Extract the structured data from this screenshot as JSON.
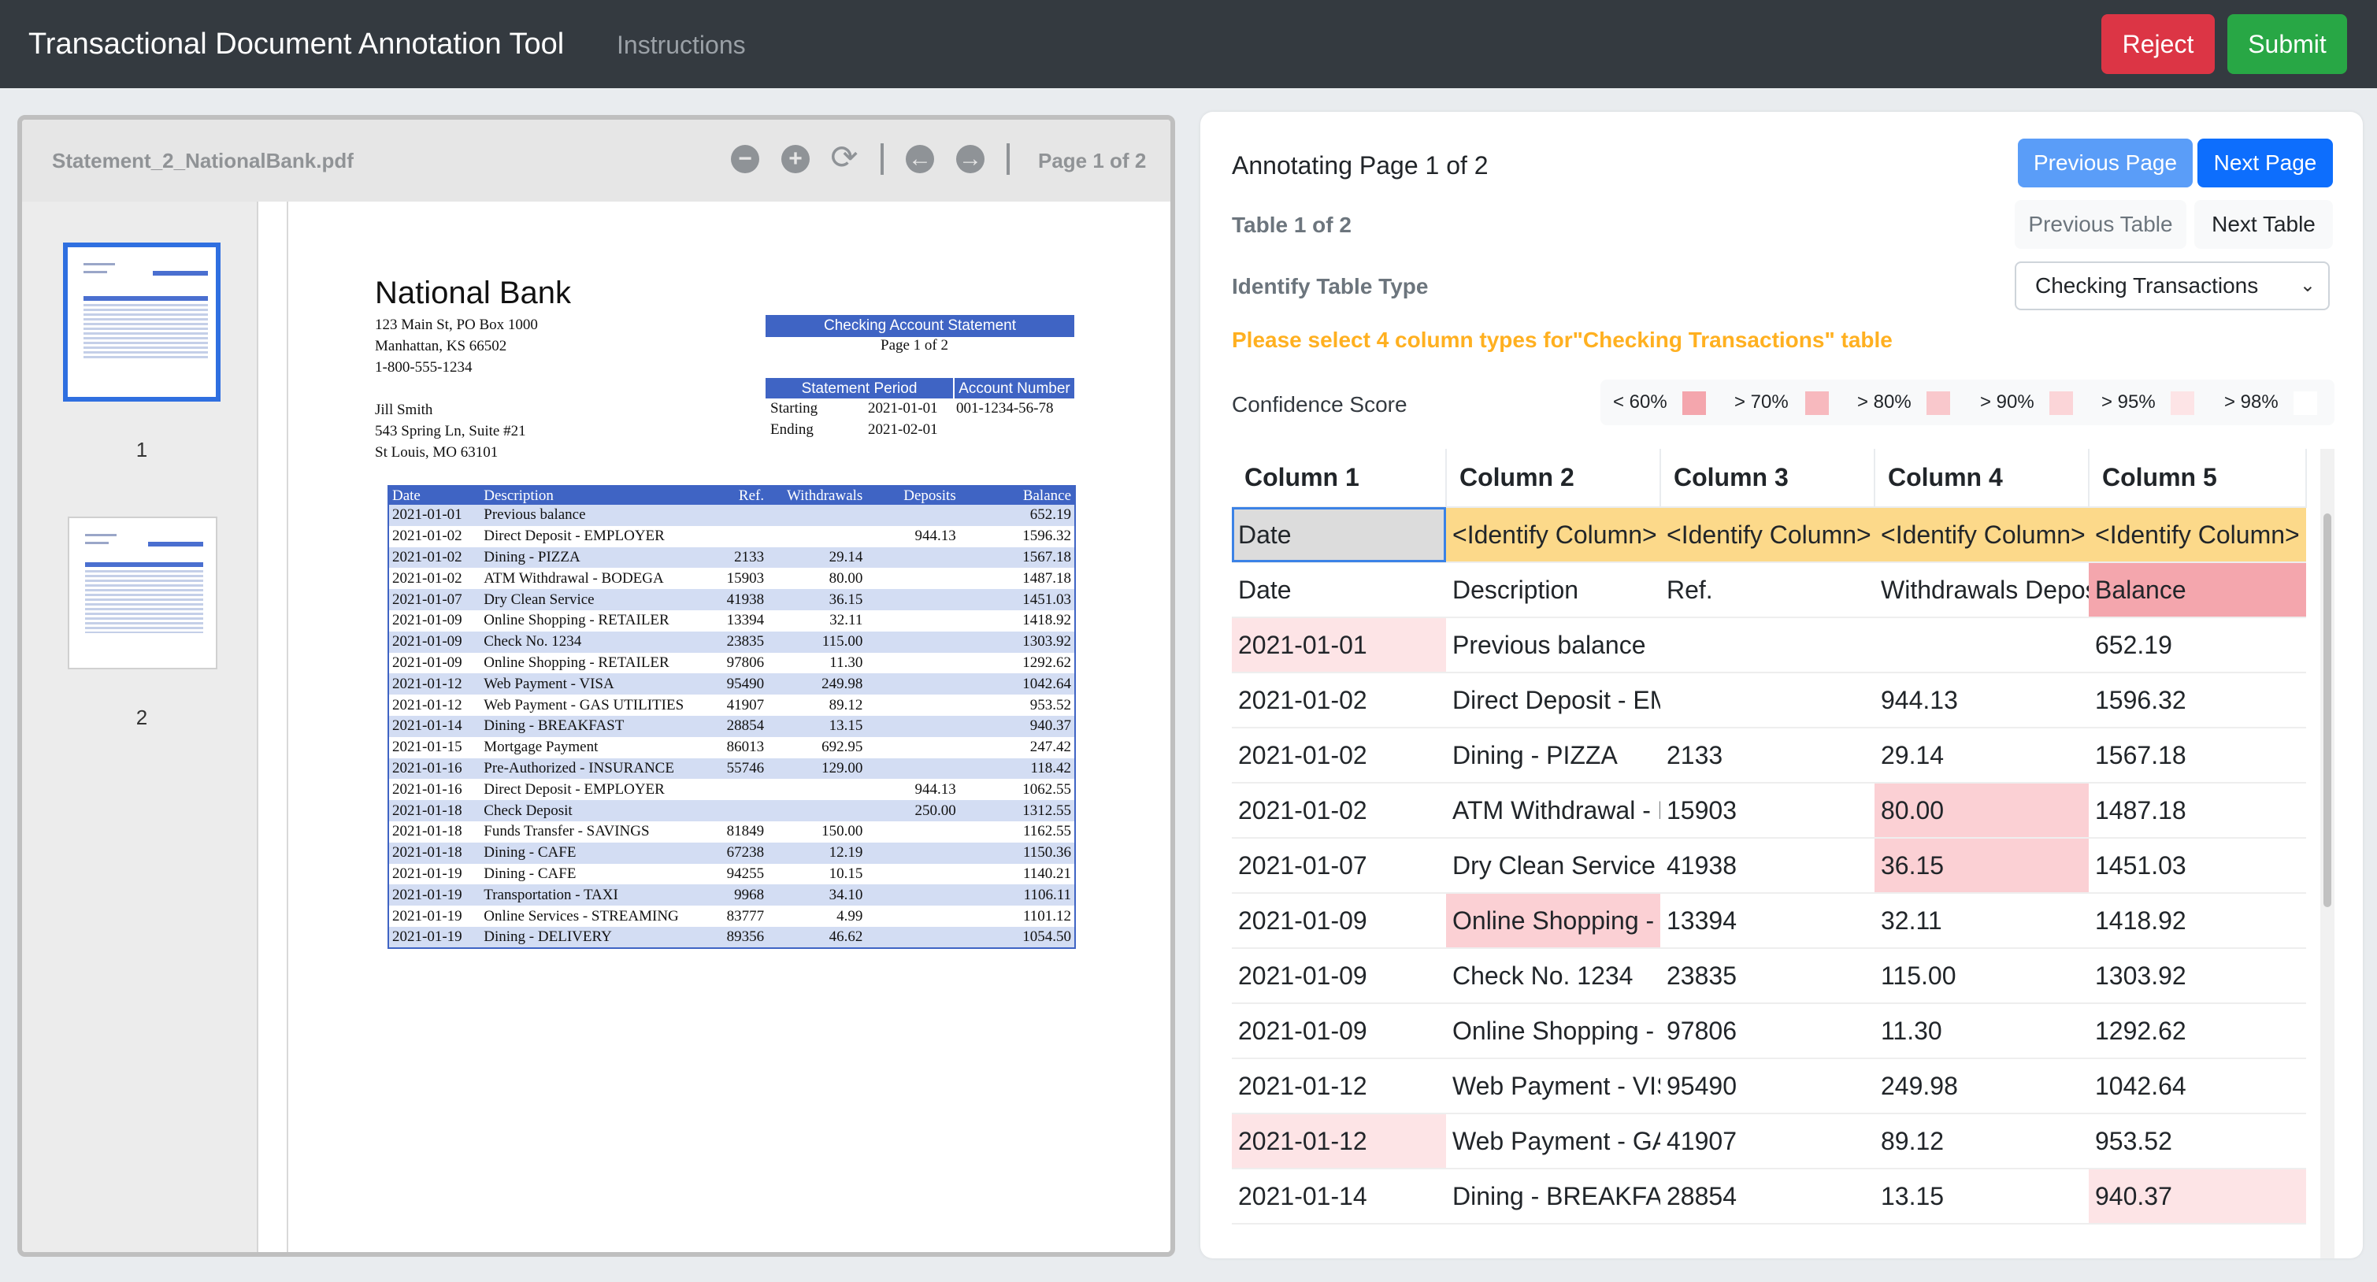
{
  "navbar": {
    "title": "Transactional Document Annotation Tool",
    "instructions": "Instructions",
    "reject_label": "Reject",
    "submit_label": "Submit"
  },
  "viewer": {
    "file_name": "Statement_2_NationalBank.pdf",
    "page_indicator": "Page 1 of 2",
    "toolbar_icons": [
      "zoom-out-icon",
      "zoom-in-icon",
      "refresh-icon",
      "arrow-left-icon",
      "arrow-right-icon"
    ],
    "thumbnails": [
      {
        "label": "1"
      },
      {
        "label": "2"
      }
    ]
  },
  "document": {
    "bank_name": "National Bank",
    "address_lines": [
      "123 Main St, PO Box 1000",
      "Manhattan, KS 66502",
      "1-800-555-1234"
    ],
    "customer_lines": [
      "Jill Smith",
      "543 Spring Ln, Suite #21",
      "St Louis, MO 63101"
    ],
    "statement_title": "Checking Account Statement",
    "statement_page": "Page 1 of 2",
    "period_header": "Statement Period",
    "account_header": "Account Number",
    "starting_label": "Starting",
    "starting_date": "2021-01-01",
    "account_number": "001-1234-56-78",
    "ending_label": "Ending",
    "ending_date": "2021-02-01",
    "table_headers": [
      "Date",
      "Description",
      "Ref.",
      "Withdrawals",
      "Deposits",
      "Balance"
    ],
    "rows": [
      [
        "2021-01-01",
        "Previous balance",
        "",
        "",
        "",
        "652.19"
      ],
      [
        "2021-01-02",
        "Direct Deposit - EMPLOYER",
        "",
        "",
        "944.13",
        "1596.32"
      ],
      [
        "2021-01-02",
        "Dining - PIZZA",
        "2133",
        "29.14",
        "",
        "1567.18"
      ],
      [
        "2021-01-02",
        "ATM Withdrawal - BODEGA",
        "15903",
        "80.00",
        "",
        "1487.18"
      ],
      [
        "2021-01-07",
        "Dry Clean Service",
        "41938",
        "36.15",
        "",
        "1451.03"
      ],
      [
        "2021-01-09",
        "Online Shopping - RETAILER",
        "13394",
        "32.11",
        "",
        "1418.92"
      ],
      [
        "2021-01-09",
        "Check No. 1234",
        "23835",
        "115.00",
        "",
        "1303.92"
      ],
      [
        "2021-01-09",
        "Online Shopping - RETAILER",
        "97806",
        "11.30",
        "",
        "1292.62"
      ],
      [
        "2021-01-12",
        "Web Payment - VISA",
        "95490",
        "249.98",
        "",
        "1042.64"
      ],
      [
        "2021-01-12",
        "Web Payment - GAS UTILITIES",
        "41907",
        "89.12",
        "",
        "953.52"
      ],
      [
        "2021-01-14",
        "Dining - BREAKFAST",
        "28854",
        "13.15",
        "",
        "940.37"
      ],
      [
        "2021-01-15",
        "Mortgage Payment",
        "86013",
        "692.95",
        "",
        "247.42"
      ],
      [
        "2021-01-16",
        "Pre-Authorized - INSURANCE",
        "55746",
        "129.00",
        "",
        "118.42"
      ],
      [
        "2021-01-16",
        "Direct Deposit - EMPLOYER",
        "",
        "",
        "944.13",
        "1062.55"
      ],
      [
        "2021-01-18",
        "Check Deposit",
        "",
        "",
        "250.00",
        "1312.55"
      ],
      [
        "2021-01-18",
        "Funds Transfer - SAVINGS",
        "81849",
        "150.00",
        "",
        "1162.55"
      ],
      [
        "2021-01-18",
        "Dining - CAFE",
        "67238",
        "12.19",
        "",
        "1150.36"
      ],
      [
        "2021-01-19",
        "Dining - CAFE",
        "94255",
        "10.15",
        "",
        "1140.21"
      ],
      [
        "2021-01-19",
        "Transportation - TAXI",
        "9968",
        "34.10",
        "",
        "1106.11"
      ],
      [
        "2021-01-19",
        "Online Services - STREAMING",
        "83777",
        "4.99",
        "",
        "1101.12"
      ],
      [
        "2021-01-19",
        "Dining - DELIVERY",
        "89356",
        "46.62",
        "",
        "1054.50"
      ]
    ]
  },
  "annotation": {
    "title": "Annotating Page 1 of 2",
    "previous_page": "Previous Page",
    "next_page": "Next Page",
    "table_label": "Table 1 of 2",
    "previous_table": "Previous Table",
    "next_table": "Next Table",
    "identify_label": "Identify Table Type",
    "table_type_selected": "Checking Transactions",
    "warning": "Please select 4 column types for\"Checking Transactions\" table",
    "confidence_label": "Confidence Score",
    "confidence_levels": [
      {
        "label": "< 60%",
        "color": "#f4a6ad"
      },
      {
        "label": "> 70%",
        "color": "#f7b9be"
      },
      {
        "label": "> 80%",
        "color": "#f9c8cc"
      },
      {
        "label": "> 90%",
        "color": "#fbd5d8"
      },
      {
        "label": "> 95%",
        "color": "#fde4e6"
      },
      {
        "label": "> 98%",
        "color": "#ffffff"
      }
    ],
    "columns": [
      "Column 1",
      "Column 2",
      "Column 3",
      "Column 4",
      "Column 5"
    ],
    "column_type_row": [
      "Date",
      "<Identify Column>",
      "<Identify Column>",
      "<Identify Column>",
      "<Identify Column>"
    ],
    "grid_rows": [
      [
        "Date",
        "Description",
        "Ref.",
        "Withdrawals Deposits",
        "Balance"
      ],
      [
        "2021-01-01",
        "Previous balance",
        "",
        "",
        "652.19"
      ],
      [
        "2021-01-02",
        "Direct Deposit - EMPLOYER",
        "",
        "944.13",
        "1596.32"
      ],
      [
        "2021-01-02",
        "Dining - PIZZA",
        "2133",
        "29.14",
        "1567.18"
      ],
      [
        "2021-01-02",
        "ATM Withdrawal - BODEGA",
        "15903",
        "80.00",
        "1487.18"
      ],
      [
        "2021-01-07",
        "Dry Clean Service",
        "41938",
        "36.15",
        "1451.03"
      ],
      [
        "2021-01-09",
        "Online Shopping - RETAILER",
        "13394",
        "32.11",
        "1418.92"
      ],
      [
        "2021-01-09",
        "Check No. 1234",
        "23835",
        "115.00",
        "1303.92"
      ],
      [
        "2021-01-09",
        "Online Shopping - RETAILER",
        "97806",
        "11.30",
        "1292.62"
      ],
      [
        "2021-01-12",
        "Web Payment - VISA",
        "95490",
        "249.98",
        "1042.64"
      ],
      [
        "2021-01-12",
        "Web Payment - GAS UTILITIES",
        "41907",
        "89.12",
        "953.52"
      ],
      [
        "2021-01-14",
        "Dining - BREAKFAST",
        "28854",
        "13.15",
        "940.37"
      ]
    ],
    "colors": {
      "accent": "#0d6efd",
      "warning": "#ffb020",
      "selected_row": "#fcd98a",
      "danger": "#dc3545",
      "success": "#28a745"
    }
  }
}
